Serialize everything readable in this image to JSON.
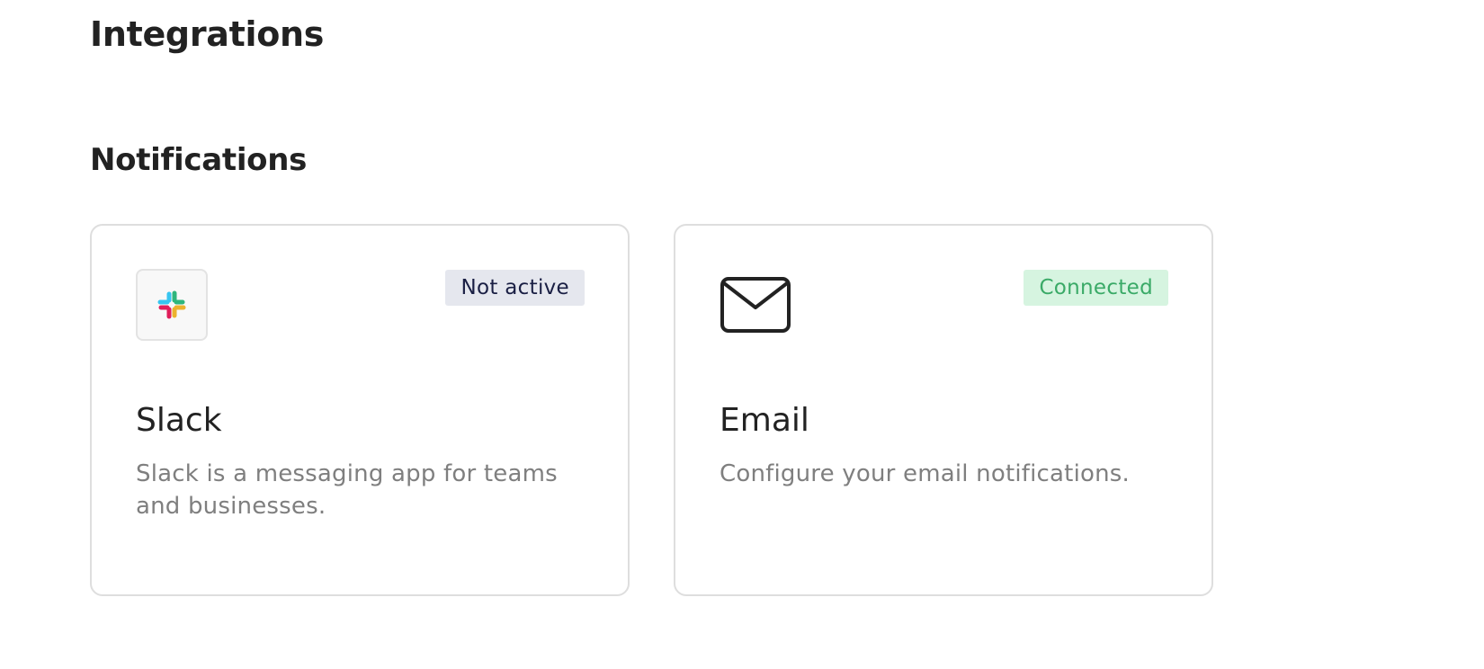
{
  "page": {
    "title": "Integrations"
  },
  "notifications": {
    "section_title": "Notifications",
    "cards": [
      {
        "name": "Slack",
        "description": "Slack is a messaging app for teams and businesses.",
        "status": "Not active",
        "icon": "slack-logo-icon",
        "status_colors": {
          "background": "#e5e7ee",
          "text": "#1a1f44"
        }
      },
      {
        "name": "Email",
        "description": "Configure your email notifications.",
        "status": "Connected",
        "icon": "mail-icon",
        "status_colors": {
          "background": "#d6f4e0",
          "text": "#3aaa67"
        }
      }
    ]
  }
}
